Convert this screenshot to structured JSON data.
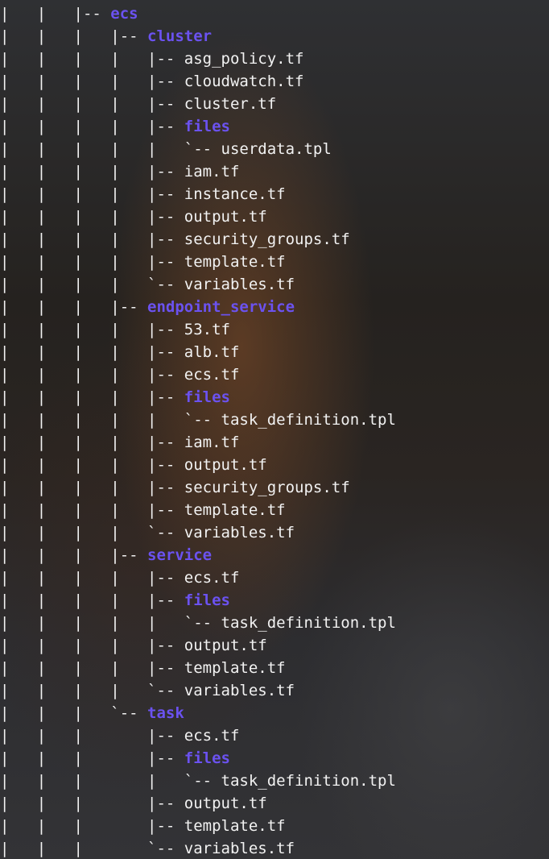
{
  "colors": {
    "text": "#f2f2f2",
    "directory": "#6b52f0"
  },
  "tree": [
    {
      "prefix": "|   |   |-- ",
      "name": "ecs",
      "dir": true
    },
    {
      "prefix": "|   |   |   |-- ",
      "name": "cluster",
      "dir": true
    },
    {
      "prefix": "|   |   |   |   |-- ",
      "name": "asg_policy.tf",
      "dir": false
    },
    {
      "prefix": "|   |   |   |   |-- ",
      "name": "cloudwatch.tf",
      "dir": false
    },
    {
      "prefix": "|   |   |   |   |-- ",
      "name": "cluster.tf",
      "dir": false
    },
    {
      "prefix": "|   |   |   |   |-- ",
      "name": "files",
      "dir": true
    },
    {
      "prefix": "|   |   |   |   |   `-- ",
      "name": "userdata.tpl",
      "dir": false
    },
    {
      "prefix": "|   |   |   |   |-- ",
      "name": "iam.tf",
      "dir": false
    },
    {
      "prefix": "|   |   |   |   |-- ",
      "name": "instance.tf",
      "dir": false
    },
    {
      "prefix": "|   |   |   |   |-- ",
      "name": "output.tf",
      "dir": false
    },
    {
      "prefix": "|   |   |   |   |-- ",
      "name": "security_groups.tf",
      "dir": false
    },
    {
      "prefix": "|   |   |   |   |-- ",
      "name": "template.tf",
      "dir": false
    },
    {
      "prefix": "|   |   |   |   `-- ",
      "name": "variables.tf",
      "dir": false
    },
    {
      "prefix": "|   |   |   |-- ",
      "name": "endpoint_service",
      "dir": true
    },
    {
      "prefix": "|   |   |   |   |-- ",
      "name": "53.tf",
      "dir": false
    },
    {
      "prefix": "|   |   |   |   |-- ",
      "name": "alb.tf",
      "dir": false
    },
    {
      "prefix": "|   |   |   |   |-- ",
      "name": "ecs.tf",
      "dir": false
    },
    {
      "prefix": "|   |   |   |   |-- ",
      "name": "files",
      "dir": true
    },
    {
      "prefix": "|   |   |   |   |   `-- ",
      "name": "task_definition.tpl",
      "dir": false
    },
    {
      "prefix": "|   |   |   |   |-- ",
      "name": "iam.tf",
      "dir": false
    },
    {
      "prefix": "|   |   |   |   |-- ",
      "name": "output.tf",
      "dir": false
    },
    {
      "prefix": "|   |   |   |   |-- ",
      "name": "security_groups.tf",
      "dir": false
    },
    {
      "prefix": "|   |   |   |   |-- ",
      "name": "template.tf",
      "dir": false
    },
    {
      "prefix": "|   |   |   |   `-- ",
      "name": "variables.tf",
      "dir": false
    },
    {
      "prefix": "|   |   |   |-- ",
      "name": "service",
      "dir": true
    },
    {
      "prefix": "|   |   |   |   |-- ",
      "name": "ecs.tf",
      "dir": false
    },
    {
      "prefix": "|   |   |   |   |-- ",
      "name": "files",
      "dir": true
    },
    {
      "prefix": "|   |   |   |   |   `-- ",
      "name": "task_definition.tpl",
      "dir": false
    },
    {
      "prefix": "|   |   |   |   |-- ",
      "name": "output.tf",
      "dir": false
    },
    {
      "prefix": "|   |   |   |   |-- ",
      "name": "template.tf",
      "dir": false
    },
    {
      "prefix": "|   |   |   |   `-- ",
      "name": "variables.tf",
      "dir": false
    },
    {
      "prefix": "|   |   |   `-- ",
      "name": "task",
      "dir": true
    },
    {
      "prefix": "|   |   |       |-- ",
      "name": "ecs.tf",
      "dir": false
    },
    {
      "prefix": "|   |   |       |-- ",
      "name": "files",
      "dir": true
    },
    {
      "prefix": "|   |   |       |   `-- ",
      "name": "task_definition.tpl",
      "dir": false
    },
    {
      "prefix": "|   |   |       |-- ",
      "name": "output.tf",
      "dir": false
    },
    {
      "prefix": "|   |   |       |-- ",
      "name": "template.tf",
      "dir": false
    },
    {
      "prefix": "|   |   |       `-- ",
      "name": "variables.tf",
      "dir": false
    }
  ]
}
